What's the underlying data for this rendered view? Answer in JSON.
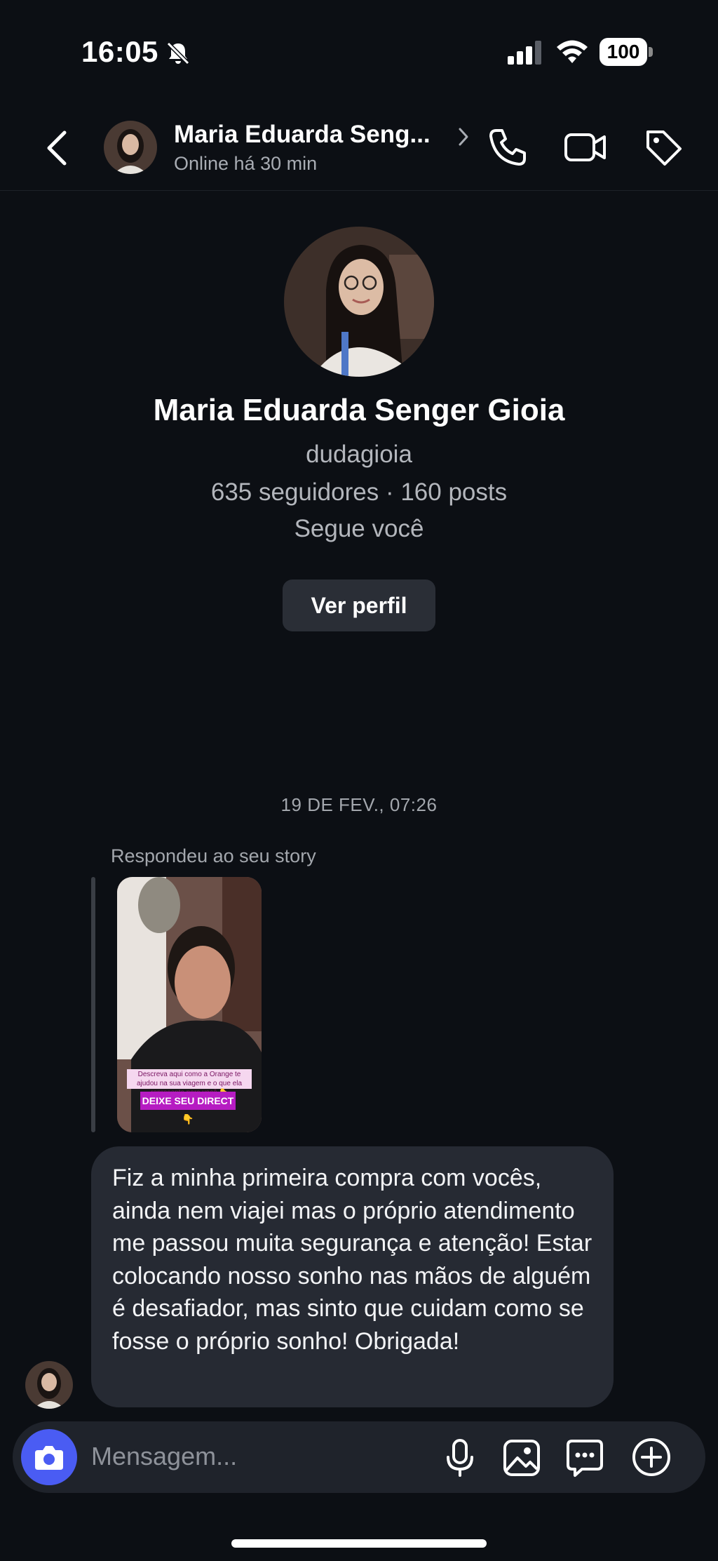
{
  "status_bar": {
    "time": "16:05",
    "battery": "100"
  },
  "header": {
    "name": "Maria Eduarda Seng...",
    "status": "Online há 30 min"
  },
  "profile": {
    "name": "Maria Eduarda Senger Gioia",
    "username": "dudagioia",
    "stats": "635 seguidores · 160 posts",
    "follow_status": "Segue você",
    "view_profile_label": "Ver perfil"
  },
  "conversation": {
    "date": "19 DE FEV., 07:26",
    "reply_label": "Respondeu ao seu story",
    "story": {
      "caption": "Descreva aqui como a Orange te ajudou na sua viagem e o que ela representa para você 👇",
      "sticker": "DEIXE SEU DIRECT 👇"
    },
    "message": "Fiz a minha primeira compra com vocês, ainda nem viajei mas o próprio atendimento me passou muita segurança e atenção! Estar colocando nosso sonho nas mãos de alguém é desafiador, mas sinto que cuidam como se fosse o próprio sonho! Obrigada!"
  },
  "composer": {
    "placeholder": "Mensagem..."
  },
  "colors": {
    "background": "#0c0f14",
    "bubble": "#262a33",
    "camera_button": "#4a5cf3",
    "secondary_text": "#a8acb3"
  },
  "icons": [
    "bell-off-icon",
    "signal-icon",
    "wifi-icon",
    "back-icon",
    "chevron-right-icon",
    "phone-icon",
    "video-icon",
    "tag-icon",
    "camera-icon",
    "microphone-icon",
    "gallery-icon",
    "sticker-icon",
    "plus-icon"
  ]
}
